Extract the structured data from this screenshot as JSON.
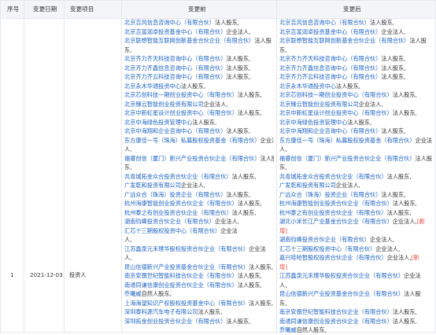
{
  "header": {
    "seq": "序号",
    "date": "变更日期",
    "item": "变更项目",
    "before": "变更前",
    "after": "变更后"
  },
  "row": {
    "seq": "1",
    "date": "2021-12-03",
    "item": "投资人"
  },
  "before_lines": [
    [
      {
        "c": "北京吉风信息咨询中心（有限合伙）"
      },
      {
        "t": "法人股东,"
      }
    ],
    [
      {
        "c": "北京吉富润卓投资基金中心（有限合伙）"
      },
      {
        "t": "企业法人,"
      }
    ],
    [
      {
        "c": "北京联想智能互联网创新基金合伙企业（有限合伙）"
      },
      {
        "t": "法人股"
      }
    ],
    [
      {
        "t": "东,"
      }
    ],
    [
      {
        "c": "北京齐力齐天科技咨询中心（有限合伙）"
      },
      {
        "t": "法人股东,"
      }
    ],
    [
      {
        "c": "北京齐力齐鑫信息咨询中心（有限合伙）"
      },
      {
        "t": "法人股东,"
      }
    ],
    [
      {
        "c": "北京齐力齐云科技咨询中心（有限合伙）"
      },
      {
        "t": "法人股东,"
      }
    ],
    [
      {
        "c": "北京永木华通投资中心"
      },
      {
        "t": "法人股东,"
      }
    ],
    [
      {
        "c": "北京芯创科技一期创业投资中心（有限合伙）"
      },
      {
        "t": "法人股东,"
      }
    ],
    [
      {
        "c": "北京臻云智能创业投资有限公司"
      },
      {
        "t": "企业法人,"
      }
    ],
    [
      {
        "c": "北京中新虹星设计创业投资中心（有限合伙）"
      },
      {
        "t": "法人股东,"
      }
    ],
    [
      {
        "c": "北京中海绿色投资管理中心"
      },
      {
        "t": "法人股东,"
      }
    ],
    [
      {
        "c": "北京中海翔和企业咨询中心（有限合伙）"
      },
      {
        "t": "法人股东,"
      }
    ],
    [
      {
        "c": "东方康佳一号（珠海）私募股权投资基金（有限合伙）"
      },
      {
        "t": "企业法"
      }
    ],
    [
      {
        "t": "人,"
      }
    ],
    [
      {
        "c": "福睿创信（厦门）新兴产业投资合伙企业（有限合伙）"
      },
      {
        "t": "法人股"
      }
    ],
    [
      {
        "t": "东,"
      }
    ],
    [
      {
        "c": "共青城拓金众合投资合伙企业（有限合伙）"
      },
      {
        "t": "法人股东,"
      }
    ],
    [
      {
        "c": "广发乾和投资有限公司"
      },
      {
        "t": "企业法人,"
      }
    ],
    [
      {
        "c": "广远众合（珠海）投资企业（有限合伙）"
      },
      {
        "t": "法人股东,"
      }
    ],
    [
      {
        "c": "杭州海康智能创业投资合伙企业（有限合伙）"
      },
      {
        "t": "法人股东,"
      }
    ],
    [
      {
        "c": "杭州泰之有创业投资合伙企业（有限合伙）"
      },
      {
        "t": "法人股东,"
      }
    ],
    [
      {
        "c": "湖南钧峰投资合伙企业（有限合伙）"
      },
      {
        "t": "企业法人,"
      }
    ],
    [
      {
        "c": "汇芯十三期股权投资中心（有限合伙）"
      },
      {
        "t": "企业法"
      }
    ],
    [
      {
        "t": "人,"
      }
    ],
    [
      {
        "c": "江苏鑫泉元禾璞华股权投资合伙企业（有限合伙）"
      },
      {
        "t": "企业法"
      }
    ],
    [
      {
        "t": "人,"
      }
    ],
    [
      {
        "c": "昆山信德新兴产业投资基金合伙企业（有限合伙）"
      },
      {
        "t": "法人股东,"
      }
    ],
    [
      {
        "c": "南京安撰世纪智能科技合伙企业（有限合伙）"
      },
      {
        "t": "法人股东,"
      }
    ],
    [
      {
        "c": "南通同谦信康创业投资合伙企业（有限合伙）"
      },
      {
        "t": "法人股东,"
      }
    ],
    [
      {
        "c": "乔曦威"
      },
      {
        "t": "自然人股东,"
      }
    ],
    [
      {
        "c": "上海海望知识产权股权投资基金中心（有限合伙）"
      },
      {
        "t": "法人股东,"
      }
    ],
    [
      {
        "c": "深圳泰科源汽车电子有限公司"
      },
      {
        "t": "法人股东,"
      }
    ],
    [
      {
        "c": "深圳拓金创业投资合伙企业（有限合伙）"
      },
      {
        "t": "法人股东,"
      }
    ]
  ],
  "after_lines": [
    [
      {
        "c": "北京吉风信息咨询中心（有限合伙）"
      },
      {
        "t": "法人股东,"
      }
    ],
    [
      {
        "c": "北京吉富润卓投资基金中心（有限合伙）"
      },
      {
        "t": "企业法人,"
      }
    ],
    [
      {
        "c": "北京联想智能互联网创新基金合伙企业（有限合伙）"
      },
      {
        "t": "法人股"
      }
    ],
    [
      {
        "t": "东,"
      }
    ],
    [
      {
        "c": "北京齐力齐天科技咨询中心（有限合伙）"
      },
      {
        "t": "法人股东,"
      }
    ],
    [
      {
        "c": "北京齐力齐鑫信息咨询中心（有限合伙）"
      },
      {
        "t": "法人股东,"
      }
    ],
    [
      {
        "c": "北京齐力齐云科技咨询中心（有限合伙）"
      },
      {
        "t": "法人股东,"
      }
    ],
    [
      {
        "c": "北京永木华通投资中心"
      },
      {
        "t": "法人股东,"
      }
    ],
    [
      {
        "c": "北京芯创科技一期创业投资中心（有限合伙）"
      },
      {
        "t": "法人股东,"
      }
    ],
    [
      {
        "c": "北京臻云智能创业投资有限公司"
      },
      {
        "t": "企业法人,"
      }
    ],
    [
      {
        "c": "北京中新虹星设计创业投资中心（有限合伙）"
      },
      {
        "t": "法人股东,"
      }
    ],
    [
      {
        "c": "北京中海绿色投资管理中心"
      },
      {
        "t": "法人股东,"
      }
    ],
    [
      {
        "c": "北京中海翔和企业咨询中心（有限合伙）"
      },
      {
        "t": "法人股东,"
      }
    ],
    [
      {
        "c": "东方康佳一号（珠海）私募股权投资基金（有限合伙）"
      },
      {
        "t": "企业法"
      }
    ],
    [
      {
        "t": "人,"
      }
    ],
    [
      {
        "c": "福睿创信（厦门）新兴产业投资合伙企业（有限合伙）"
      },
      {
        "t": "法人股"
      }
    ],
    [
      {
        "t": "东,"
      }
    ],
    [
      {
        "c": "共青城拓金众合投资合伙企业（有限合伙）"
      },
      {
        "t": "法人股东,"
      }
    ],
    [
      {
        "c": "广发乾和投资有限公司"
      },
      {
        "t": "企业法人,"
      }
    ],
    [
      {
        "c": "广远众合（珠海）投资企业（有限合伙）"
      },
      {
        "t": "法人股东,"
      }
    ],
    [
      {
        "c": "杭州海康智能创业投资合伙企业（有限合伙）"
      },
      {
        "t": "法人股东,"
      }
    ],
    [
      {
        "c": "杭州泰之有创业投资合伙企业（有限合伙）"
      },
      {
        "t": "法人股东,"
      }
    ],
    [
      {
        "c": "湖北小米长江产业基金合伙企业（有限合伙）"
      },
      {
        "t": "企业法人,"
      },
      {
        "n": "[新"
      }
    ],
    [
      {
        "n": "增]"
      }
    ],
    [
      {
        "c": "湖南钧峰投资合伙企业（有限合伙）"
      },
      {
        "t": "企业法人,"
      }
    ],
    [
      {
        "c": "汇芯十三期股权投资中心（有限合伙）"
      },
      {
        "t": "企业法人,"
      }
    ],
    [
      {
        "c": "嘉兴哇哈智股权投资合伙企业（有限合伙）"
      },
      {
        "t": "企业法人,"
      },
      {
        "n": "[新"
      }
    ],
    [
      {
        "n": "增]"
      }
    ],
    [
      {
        "c": "江苏鑫泉元禾璞华股权投资合伙企业（有限合伙）"
      },
      {
        "t": "企业法"
      }
    ],
    [
      {
        "t": "人,"
      }
    ],
    [
      {
        "c": "昆山信德新兴产业投资基金合伙企业（有限合伙）"
      },
      {
        "t": "法人股"
      }
    ],
    [
      {
        "t": "东,"
      }
    ],
    [
      {
        "c": "南京安撰世纪智能科技合伙企业（有限合伙）"
      },
      {
        "t": "法人股东,"
      }
    ],
    [
      {
        "c": "南通同谦信康创业投资合伙企业（有限合伙）"
      },
      {
        "t": "法人股东,"
      }
    ],
    [
      {
        "c": "乔曦威"
      },
      {
        "t": "自然人股东,"
      }
    ]
  ]
}
